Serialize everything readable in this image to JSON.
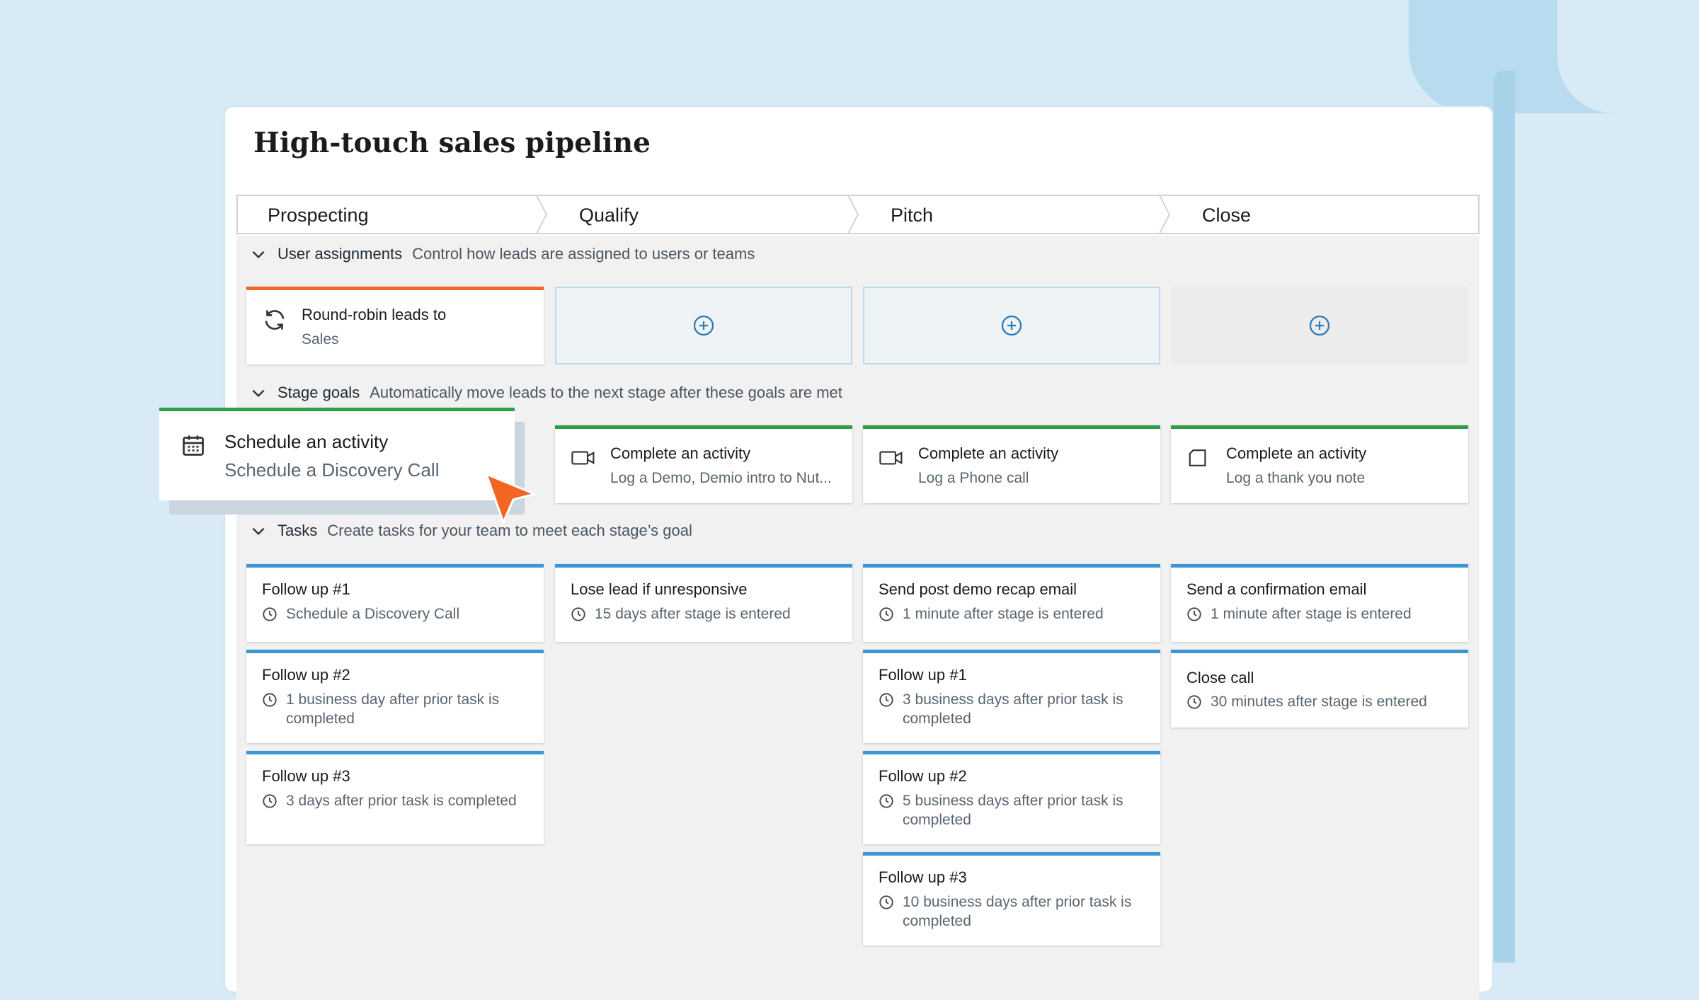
{
  "title": "High-touch sales pipeline",
  "stages": [
    "Prospecting",
    "Qualify",
    "Pitch",
    "Close"
  ],
  "sections": {
    "user_assignments": {
      "name": "User assignments",
      "desc": "Control how leads are assigned to users or teams"
    },
    "stage_goals": {
      "name": "Stage goals",
      "desc": "Automatically move leads to the next stage after these goals are met"
    },
    "tasks": {
      "name": "Tasks",
      "desc": "Create tasks for your team to meet each stage’s goal"
    }
  },
  "assignment_card": {
    "title": "Round-robin leads to",
    "subtitle": "Sales",
    "icon": "refresh-icon"
  },
  "dragged_goal": {
    "title": "Schedule an activity",
    "subtitle": "Schedule a Discovery Call",
    "icon": "calendar-icon"
  },
  "goals": [
    {
      "title": "Complete an activity",
      "subtitle": "Log a Demo, Demio intro to Nut...",
      "icon": "video-icon"
    },
    {
      "title": "Complete an activity",
      "subtitle": "Log a Phone call",
      "icon": "video-icon"
    },
    {
      "title": "Complete an activity",
      "subtitle": "Log a thank you note",
      "icon": "note-icon"
    }
  ],
  "tasks": {
    "prospecting": [
      {
        "title": "Follow up #1",
        "subtitle": "Schedule a Discovery Call"
      },
      {
        "title": "Follow up #2",
        "subtitle": "1 business day after prior task is completed"
      },
      {
        "title": "Follow up #3",
        "subtitle": "3 days after prior task is completed"
      }
    ],
    "qualify": [
      {
        "title": "Lose lead if unresponsive",
        "subtitle": "15 days after stage is entered"
      }
    ],
    "pitch": [
      {
        "title": "Send post demo recap email",
        "subtitle": "1 minute after stage is entered"
      },
      {
        "title": "Follow up #1",
        "subtitle": "3 business days after prior task is completed"
      },
      {
        "title": "Follow up #2",
        "subtitle": "5 business days after prior task is completed"
      },
      {
        "title": "Follow up #3",
        "subtitle": "10 business days after prior task is completed"
      }
    ],
    "close": [
      {
        "title": "Send a confirmation email",
        "subtitle": "1 minute after stage is entered"
      },
      {
        "title": "Close call",
        "subtitle": "30 minutes after stage is entered"
      }
    ]
  },
  "colors": {
    "accent_orange": "#f0652a",
    "goal_green": "#2e9e4b",
    "task_blue": "#3b97d3",
    "cursor": "#f26522"
  }
}
